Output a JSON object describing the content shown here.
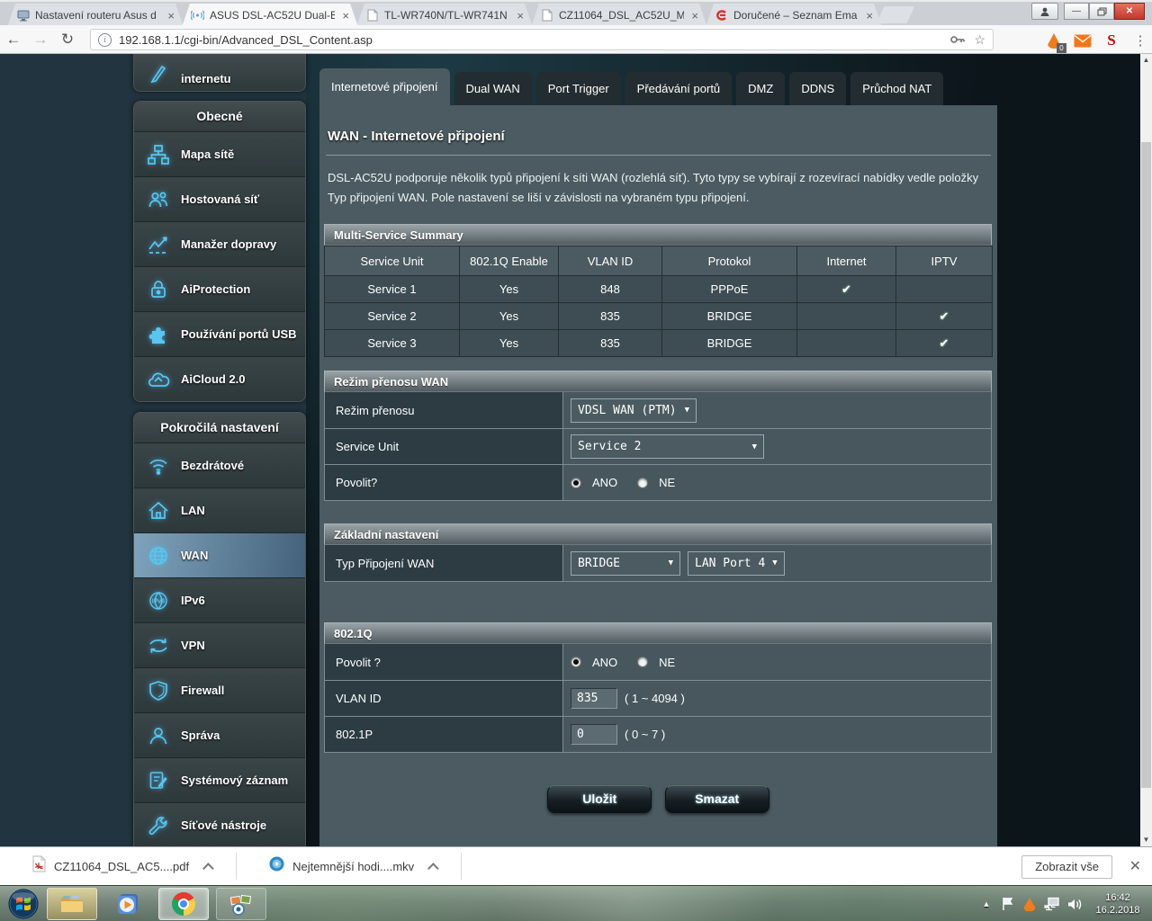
{
  "colors": {
    "accent_cyan": "#57c7f2",
    "check_green": "#46b42a",
    "selected_blue": "#4e7089",
    "avast_orange": "#f07d1a"
  },
  "browser": {
    "tabs": [
      {
        "title": "Nastavení routeru Asus d",
        "icon": "monitor-icon",
        "close": "×"
      },
      {
        "title": "ASUS DSL-AC52U Dual-B",
        "icon": "wifi-signal-icon",
        "close": "×"
      },
      {
        "title": "TL-WR740N/TL-WR741N",
        "icon": "page-icon",
        "close": "×"
      },
      {
        "title": "CZ11064_DSL_AC52U_M",
        "icon": "page-icon",
        "close": "×"
      },
      {
        "title": "Doručené – Seznam Ema",
        "icon": "seznam-email-icon",
        "close": "×"
      },
      {
        "title": "",
        "icon": "",
        "close": ""
      },
      {
        "title": "",
        "icon": "",
        "close": ""
      }
    ],
    "url": "192.168.1.1/cgi-bin/Advanced_DSL_Content.asp",
    "avast_badge": "0",
    "menu_dots": "⋮",
    "star": "☆",
    "back": "←",
    "forward": "→",
    "reload": "↻",
    "info": "i",
    "min": "—",
    "close_win": "✕"
  },
  "sidebar": {
    "quick_label": "internetu",
    "groups": [
      {
        "header": "Obecné",
        "items": [
          {
            "label": "Mapa sítě"
          },
          {
            "label": "Hostovaná síť"
          },
          {
            "label": "Manažer dopravy"
          },
          {
            "label": "AiProtection"
          },
          {
            "label": "Používání portů USB"
          },
          {
            "label": "AiCloud 2.0"
          }
        ]
      },
      {
        "header": "Pokročilá nastavení",
        "items": [
          {
            "label": "Bezdrátové"
          },
          {
            "label": "LAN"
          },
          {
            "label": "WAN",
            "selected": true
          },
          {
            "label": "IPv6"
          },
          {
            "label": "VPN"
          },
          {
            "label": "Firewall"
          },
          {
            "label": "Správa"
          },
          {
            "label": "Systémový záznam"
          },
          {
            "label": "Síťové nástroje"
          }
        ]
      }
    ]
  },
  "content": {
    "tabs": [
      "Internetové připojení",
      "Dual WAN",
      "Port Trigger",
      "Předávání portů",
      "DMZ",
      "DDNS",
      "Průchod NAT"
    ],
    "active_tab": "Internetové připojení",
    "title": "WAN - Internetové připojení",
    "description": "DSL-AC52U podporuje několik typů připojení k síti WAN (rozlehlá síť). Tyto typy se vybírají z rozevírací nabídky vedle položky Typ připojení WAN. Pole nastavení se liší v závislosti na vybraném typu připojení.",
    "summary_table": {
      "header": "Multi-Service Summary",
      "columns": [
        "Service Unit",
        "802.1Q Enable",
        "VLAN ID",
        "Protokol",
        "Internet",
        "IPTV"
      ],
      "rows": [
        [
          "Service 1",
          "Yes",
          "848",
          "PPPoE",
          "✔",
          ""
        ],
        [
          "Service 2",
          "Yes",
          "835",
          "BRIDGE",
          "",
          "✔"
        ],
        [
          "Service 3",
          "Yes",
          "835",
          "BRIDGE",
          "",
          "✔"
        ]
      ]
    },
    "wan_mode_section": {
      "header": "Režim přenosu WAN",
      "row1_label": "Režim přenosu",
      "row1_value": "VDSL WAN (PTM)",
      "row2_label": "Service Unit",
      "row2_value": "Service 2",
      "row3_label": "Povolit?",
      "opt_yes": "ANO",
      "opt_no": "NE",
      "selected": "ANO",
      "caret": "▼"
    },
    "basic_section": {
      "header": "Základní nastavení",
      "row_label": "Typ Připojení WAN",
      "dropdown1": "BRIDGE",
      "dropdown2": "LAN Port 4",
      "caret": "▼"
    },
    "vlan_section": {
      "header": "802.1Q",
      "enable_label": "Povolit ?",
      "opt_yes": "ANO",
      "opt_no": "NE",
      "selected": "ANO",
      "vlan_label": "VLAN ID",
      "vlan_value": "835",
      "vlan_range": "( 1 ~ 4094 )",
      "p_label": "802.1P",
      "p_value": "0",
      "p_range": "( 0 ~ 7 )"
    },
    "buttons": {
      "save": "Uložit",
      "delete": "Smazat"
    }
  },
  "downloads": {
    "items": [
      {
        "name": "CZ11064_DSL_AC5....pdf",
        "icon": "pdf-icon"
      },
      {
        "name": "Nejtemnější hodi....mkv",
        "icon": "media-file-icon"
      }
    ],
    "show_all": "Zobrazit vše",
    "close": "✕"
  },
  "taskbar": {
    "time": "16:42",
    "date": "16.2.2018",
    "hidden_icons": "▲"
  }
}
